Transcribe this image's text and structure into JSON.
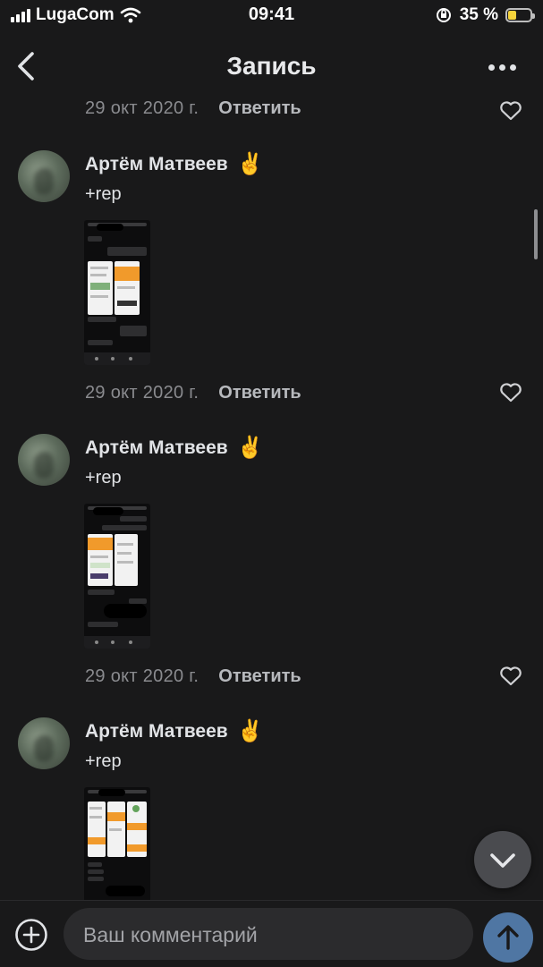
{
  "status_bar": {
    "carrier": "LugaCom",
    "time": "09:41",
    "battery_percent": "35 %",
    "battery_level": 0.35
  },
  "header": {
    "title": "Запись"
  },
  "top_meta": {
    "date": "29 окт 2020 г.",
    "reply_label": "Ответить"
  },
  "comments": [
    {
      "author": "Артём Матвеев",
      "author_emoji": "✌️",
      "text": "+rep",
      "date": "29 окт 2020 г.",
      "reply_label": "Ответить"
    },
    {
      "author": "Артём Матвеев",
      "author_emoji": "✌️",
      "text": "+rep",
      "date": "29 окт 2020 г.",
      "reply_label": "Ответить"
    },
    {
      "author": "Артём Матвеев",
      "author_emoji": "✌️",
      "text": "+rep"
    }
  ],
  "composer": {
    "placeholder": "Ваш комментарий"
  },
  "icons": {
    "back": "chevron-left-icon",
    "more": "more-horizontal-icon",
    "like": "heart-icon",
    "add": "plus-circle-icon",
    "emoji": "smile-icon",
    "send": "arrow-up-icon",
    "scroll_down": "chevron-down-icon"
  },
  "colors": {
    "background": "#19191a",
    "send_button": "#4f76a3",
    "secondary_text": "#8a8b8f"
  }
}
